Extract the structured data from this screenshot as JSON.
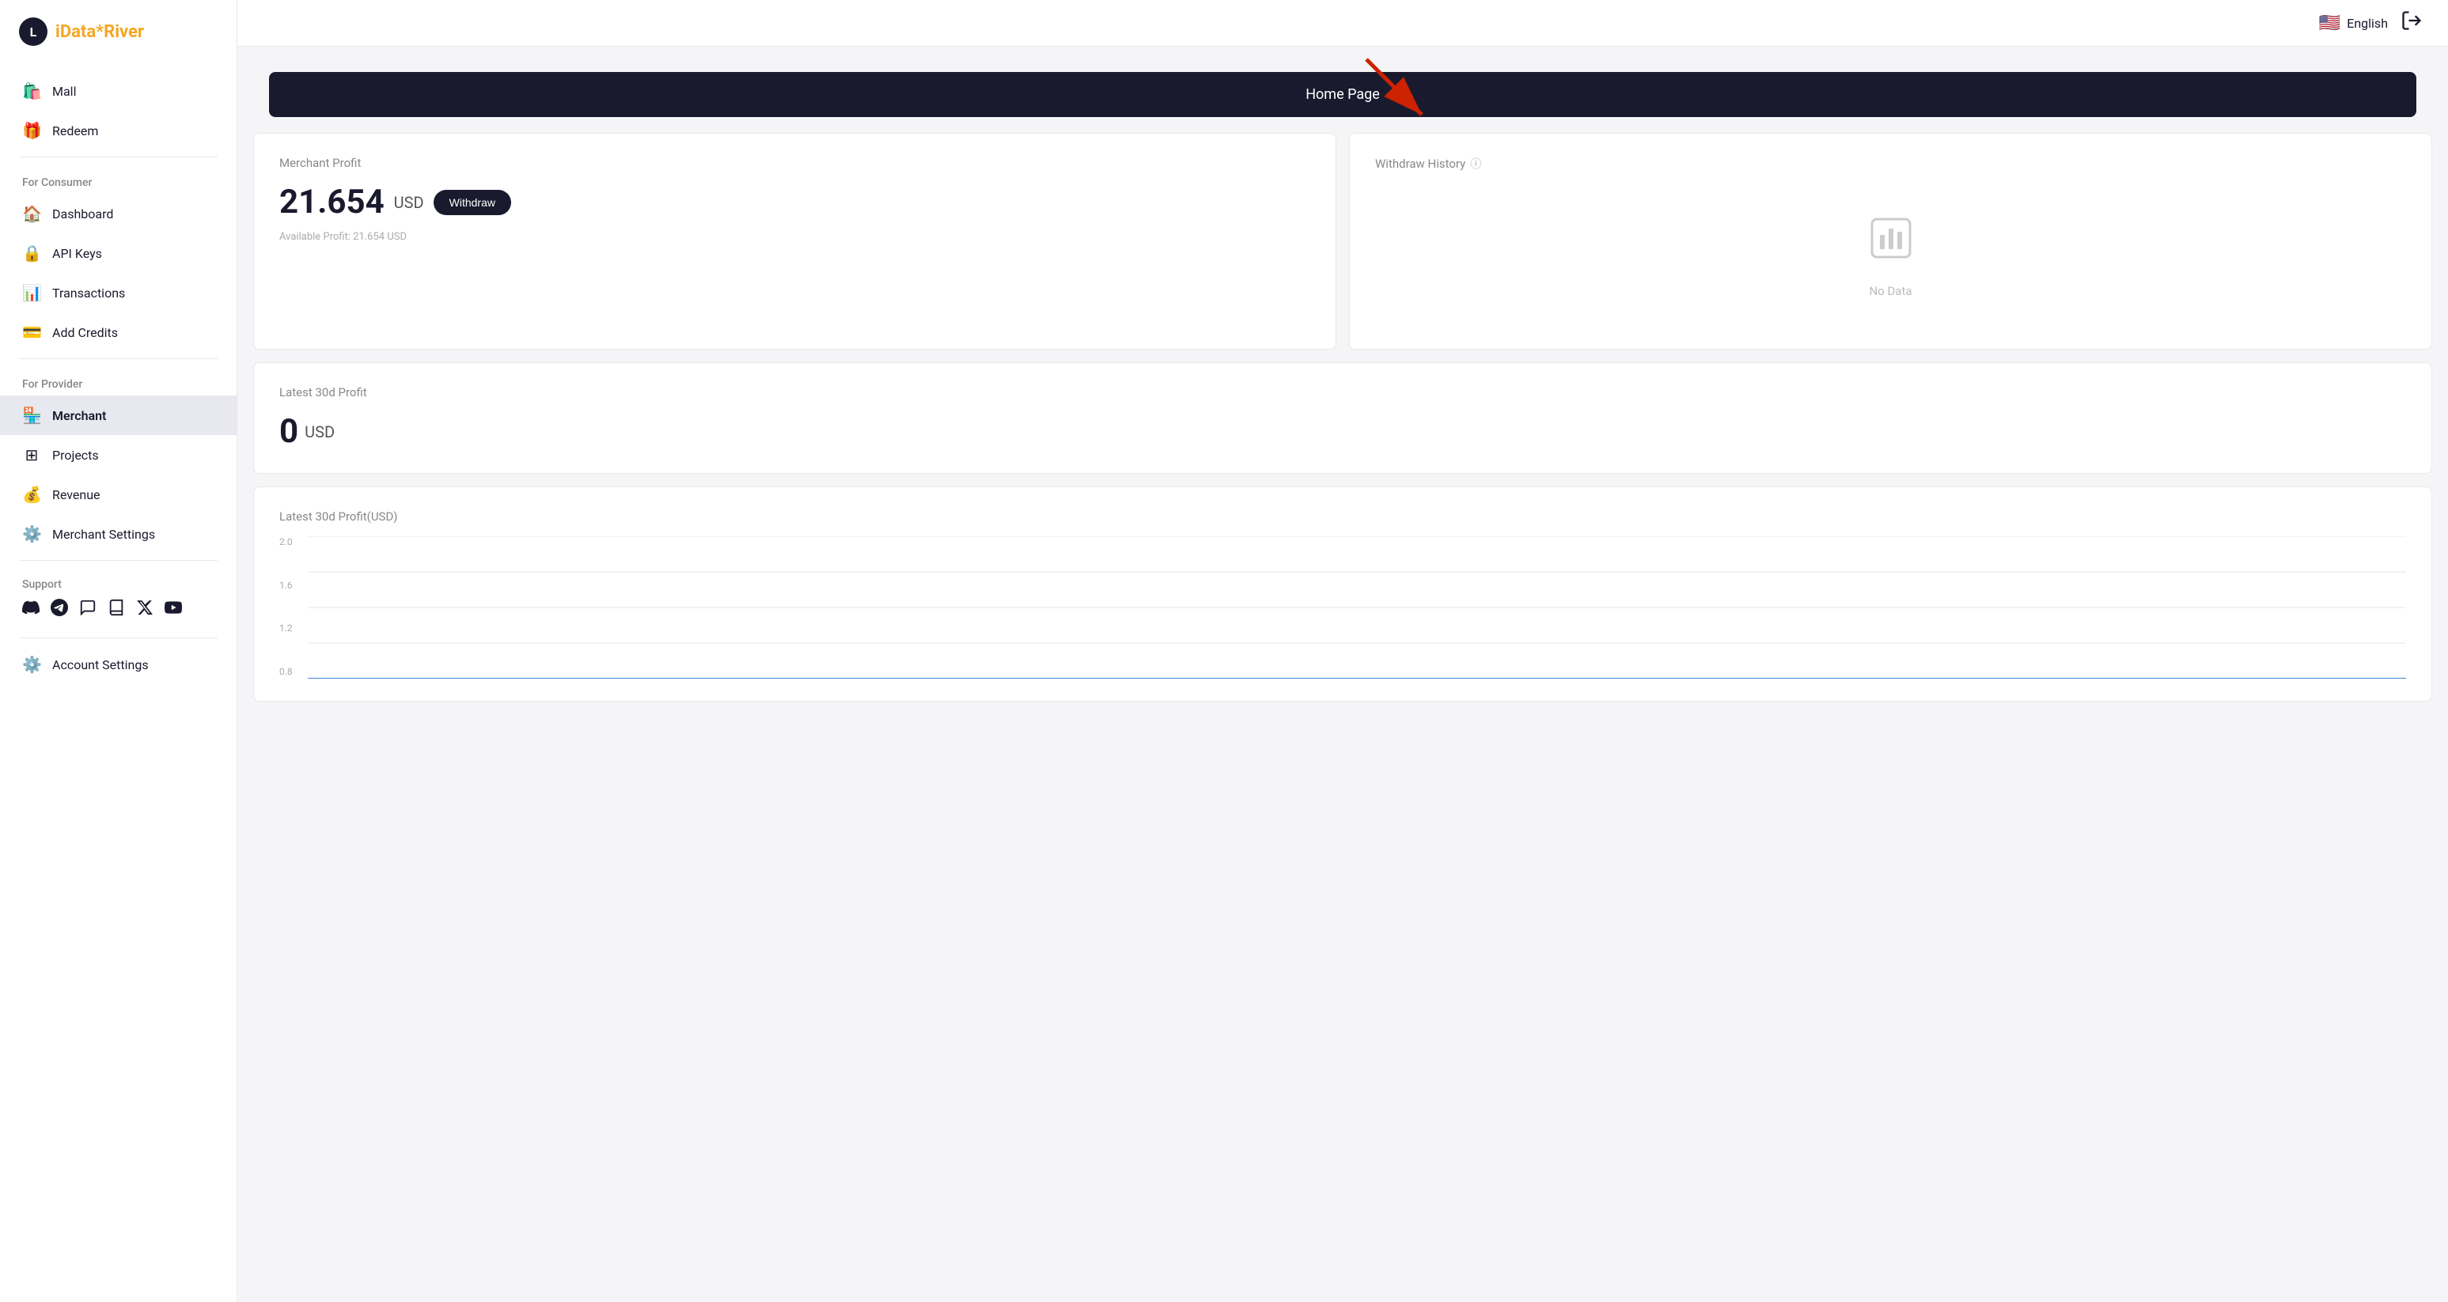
{
  "app": {
    "name": "iData",
    "name_highlight": "*River",
    "logo_letter": "L"
  },
  "topbar": {
    "language_label": "English",
    "flag": "🇺🇸"
  },
  "homepage_bar": {
    "label": "Home Page"
  },
  "sidebar": {
    "top_items": [
      {
        "id": "mall",
        "label": "Mall",
        "icon": "🛍️"
      },
      {
        "id": "redeem",
        "label": "Redeem",
        "icon": "🎁"
      }
    ],
    "consumer_section": "For Consumer",
    "consumer_items": [
      {
        "id": "dashboard",
        "label": "Dashboard",
        "icon": "🏠"
      },
      {
        "id": "api-keys",
        "label": "API Keys",
        "icon": "🔒"
      },
      {
        "id": "transactions",
        "label": "Transactions",
        "icon": "📊"
      },
      {
        "id": "add-credits",
        "label": "Add Credits",
        "icon": "💳"
      }
    ],
    "provider_section": "For Provider",
    "provider_items": [
      {
        "id": "merchant",
        "label": "Merchant",
        "icon": "🏪",
        "active": true
      },
      {
        "id": "projects",
        "label": "Projects",
        "icon": "⊞"
      },
      {
        "id": "revenue",
        "label": "Revenue",
        "icon": "💰"
      },
      {
        "id": "merchant-settings",
        "label": "Merchant Settings",
        "icon": "⚙️"
      }
    ],
    "support_section": "Support",
    "support_icons": [
      "discord",
      "telegram",
      "support",
      "book",
      "x",
      "youtube"
    ],
    "bottom_items": [
      {
        "id": "account-settings",
        "label": "Account Settings",
        "icon": "⚙️"
      }
    ]
  },
  "main_content": {
    "merchant_profit_label": "Merchant Profit",
    "merchant_profit_value": "21.654",
    "merchant_profit_unit": "USD",
    "withdraw_label": "Withdraw",
    "available_profit_label": "Available Profit: 21.654 USD",
    "withdraw_history_label": "Withdraw History",
    "info_icon": "ⓘ",
    "no_data_label": "No Data",
    "latest_30d_label": "Latest 30d Profit",
    "latest_30d_value": "0",
    "latest_30d_unit": "USD",
    "chart_title": "Latest 30d Profit(USD)",
    "chart_y_labels": [
      "2.0",
      "1.6",
      "1.2",
      "0.8"
    ],
    "chart_data": {
      "points": [
        0,
        0,
        0,
        0,
        0,
        0,
        0,
        0,
        0,
        0,
        0,
        0,
        0,
        0,
        0,
        0,
        0,
        0,
        0,
        0,
        0,
        0,
        0,
        0,
        0,
        0,
        0,
        0,
        0,
        0
      ],
      "max": 2.0
    }
  }
}
